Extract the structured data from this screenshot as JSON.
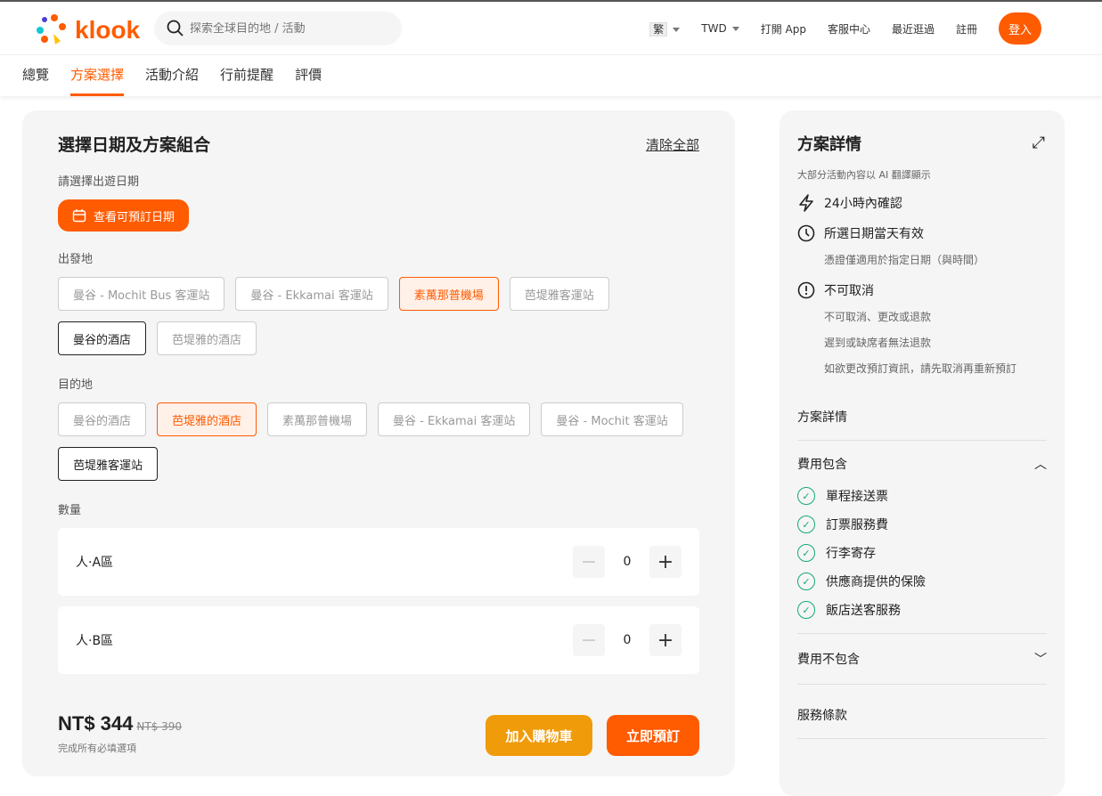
{
  "header": {
    "brand": "klook",
    "search_placeholder": "探索全球目的地 / 活動",
    "lang": "繁",
    "currency": "TWD",
    "links": [
      "打開 App",
      "客服中心",
      "最近逛過",
      "註冊"
    ],
    "login": "登入"
  },
  "tabs": [
    "總覽",
    "方案選擇",
    "活動介紹",
    "行前提醒",
    "評價"
  ],
  "booking": {
    "title": "選擇日期及方案組合",
    "clear_all": "清除全部",
    "date_label": "請選擇出遊日期",
    "date_button": "查看可預訂日期",
    "origin_label": "出發地",
    "origins": [
      "曼谷 - Mochit Bus 客運站",
      "曼谷 - Ekkamai 客運站",
      "素萬那普機場",
      "芭堤雅客運站",
      "曼谷的酒店",
      "芭堤雅的酒店"
    ],
    "dest_label": "目的地",
    "destinations": [
      "曼谷的酒店",
      "芭堤雅的酒店",
      "素萬那普機場",
      "曼谷 - Ekkamai 客運站",
      "曼谷 - Mochit 客運站",
      "芭堤雅客運站"
    ],
    "qty_label": "數量",
    "quantities": [
      {
        "name": "人·A區",
        "value": "0"
      },
      {
        "name": "人·B區",
        "value": "0"
      }
    ],
    "price": "NT$ 344",
    "old_price": "NT$ 390",
    "price_note": "完成所有必填選項",
    "add_cart": "加入購物車",
    "book_now": "立即預訂"
  },
  "details": {
    "title": "方案詳情",
    "ai_note": "大部分活動內容以 AI 翻譯顯示",
    "confirm": "24小時內確認",
    "valid": "所選日期當天有效",
    "valid_sub": "憑證僅適用於指定日期（與時間）",
    "cancel": "不可取消",
    "cancel_subs": [
      "不可取消、更改或退款",
      "遲到或缺席者無法退款",
      "如欲更改預訂資訊，請先取消再重新預訂"
    ],
    "sec_details": "方案詳情",
    "sec_included": "費用包含",
    "included": [
      "單程接送票",
      "訂票服務費",
      "行李寄存",
      "供應商提供的保險",
      "飯店送客服務"
    ],
    "sec_excluded": "費用不包含",
    "sec_terms": "服務條款"
  },
  "colors": {
    "brand": "#ff5b00",
    "cart": "#f09b0a",
    "check": "#16a87a"
  }
}
